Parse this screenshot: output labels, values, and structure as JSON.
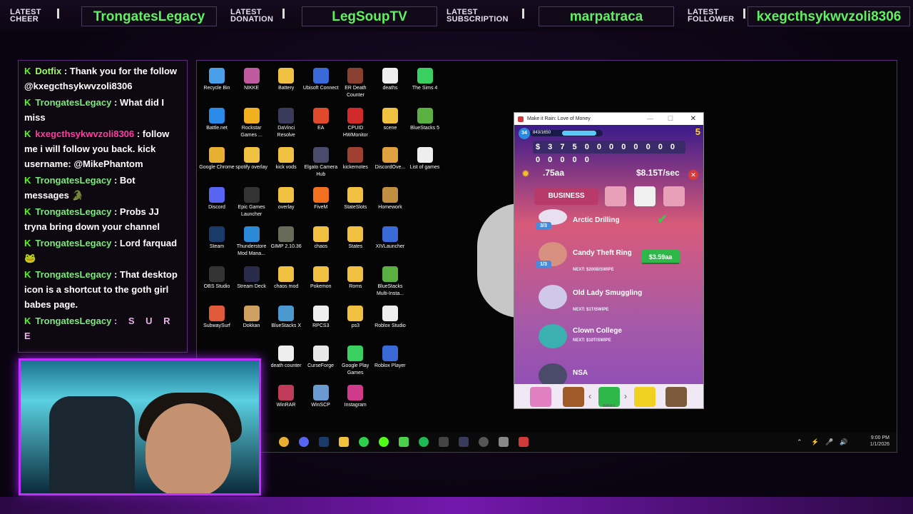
{
  "alerts": [
    {
      "tag_line1": "LATEST",
      "tag_line2": "CHEER",
      "value": "TrongatesLegacy"
    },
    {
      "tag_line1": "LATEST",
      "tag_line2": "DONATION",
      "value": "LegSoupTV"
    },
    {
      "tag_line1": "LATEST",
      "tag_line2": "SUBSCRIPTION",
      "value": "marpatraca"
    },
    {
      "tag_line1": "LATEST",
      "tag_line2": "FOLLOWER",
      "value": "kxegcthsykwvzoli8306"
    }
  ],
  "chat": {
    "messages": [
      {
        "user": "Dotfix",
        "text": ": Thank you for the follow @kxegcthsykwvzoli8306"
      },
      {
        "user": "TrongatesLegacy",
        "text": ": What did I miss"
      },
      {
        "user": "kxegcthsykwvzoli8306",
        "text": ": follow me i will follow you back. kick username: @MikePhantom"
      },
      {
        "user": "TrongatesLegacy",
        "text": ": Bot messages"
      },
      {
        "user": "TrongatesLegacy",
        "text": ": Probs JJ tryna bring down your channel"
      },
      {
        "user": "TrongatesLegacy",
        "text": ": Lord farquad"
      },
      {
        "user": "TrongatesLegacy",
        "text": ": That desktop icon is a shortcut to the goth girl babes page."
      },
      {
        "user": "TrongatesLegacy",
        "text": ": S U R E"
      }
    ]
  },
  "desktop_icons": [
    {
      "label": "Recycle Bin",
      "color": "#4aa0e8"
    },
    {
      "label": "NIKKE",
      "color": "#c05aa0"
    },
    {
      "label": "Battery",
      "color": "#f0c040"
    },
    {
      "label": "Ubisoft Connect",
      "color": "#3a6ad8"
    },
    {
      "label": "ER Death Counter",
      "color": "#8a4030"
    },
    {
      "label": "deaths",
      "color": "#eeeeee"
    },
    {
      "label": "The Sims 4",
      "color": "#3ad060"
    },
    {
      "label": "Battle.net",
      "color": "#2a8ae8"
    },
    {
      "label": "Rockstar Games ...",
      "color": "#f0b020"
    },
    {
      "label": "DaVinci Resolve",
      "color": "#3a3a5a"
    },
    {
      "label": "EA",
      "color": "#e04a2a"
    },
    {
      "label": "CPUID HWMonitor",
      "color": "#d02a2a"
    },
    {
      "label": "scene",
      "color": "#f0c040"
    },
    {
      "label": "BlueStacks 5",
      "color": "#5ab040"
    },
    {
      "label": "Google Chrome",
      "color": "#e8b030"
    },
    {
      "label": "spotify overlay",
      "color": "#f0c040"
    },
    {
      "label": "kick vods",
      "color": "#f0c040"
    },
    {
      "label": "Elgato Camera Hub",
      "color": "#4a4a6a"
    },
    {
      "label": "kickemotes",
      "color": "#a04030"
    },
    {
      "label": "DiscordOve...",
      "color": "#e0a040"
    },
    {
      "label": "List of games",
      "color": "#eeeeee"
    },
    {
      "label": "Discord",
      "color": "#5865f2"
    },
    {
      "label": "Epic Games Launcher",
      "color": "#333333"
    },
    {
      "label": "overlay",
      "color": "#f0c040"
    },
    {
      "label": "FiveM",
      "color": "#f07020"
    },
    {
      "label": "StateSlots",
      "color": "#f0c040"
    },
    {
      "label": "Homework",
      "color": "#c09040"
    },
    {
      "label": "Steam",
      "color": "#1a3a6a"
    },
    {
      "label": "Thunderstore Mod Mana...",
      "color": "#2a8ad8"
    },
    {
      "label": "GIMP 2.10.36",
      "color": "#6a6a5a"
    },
    {
      "label": "chaos",
      "color": "#f0c040"
    },
    {
      "label": "States",
      "color": "#f0c040"
    },
    {
      "label": "XIVLauncher",
      "color": "#3a6ad8"
    },
    {
      "label": "OBS Studio",
      "color": "#333333"
    },
    {
      "label": "Stream Deck",
      "color": "#2a2a4a"
    },
    {
      "label": "chaos mod",
      "color": "#f0c040"
    },
    {
      "label": "Pokemon",
      "color": "#f0c040"
    },
    {
      "label": "Roms",
      "color": "#f0c040"
    },
    {
      "label": "BlueStacks Multi-Insta...",
      "color": "#5ab040"
    },
    {
      "label": "SubwaySurf",
      "color": "#e05a3a"
    },
    {
      "label": "Dokkan",
      "color": "#d0a060"
    },
    {
      "label": "BlueStacks X",
      "color": "#4a9ad0"
    },
    {
      "label": "RPCS3",
      "color": "#eeeeee"
    },
    {
      "label": "ps3",
      "color": "#f0c040"
    },
    {
      "label": "Roblox Studio",
      "color": "#eeeeee"
    },
    {
      "label": "death counter",
      "color": "#eeeeee"
    },
    {
      "label": "CurseForge",
      "color": "#e8e8e8"
    },
    {
      "label": "Google Play Games",
      "color": "#3ad060"
    },
    {
      "label": "Roblox Player",
      "color": "#3a6ad8"
    },
    {
      "label": "WinRAR",
      "color": "#c03a5a"
    },
    {
      "label": "WinSCP",
      "color": "#6a9ad0"
    },
    {
      "label": "Instagram",
      "color": "#d03a8a"
    }
  ],
  "game": {
    "window_title": "Make it Rain: Love of Money",
    "level": "34",
    "xp": "843/1650",
    "xp_fraction": 0.51,
    "coins": "5",
    "counter": "$ 3 7 5 0 0 0 0 0 0 0 0 0 0 0 0 0",
    "money_left": ".75aa",
    "money_right": "$8.15T/sec",
    "tab_label": "BUSINESS",
    "businesses": [
      {
        "name": "Arctic Drilling",
        "badge": "3/3",
        "next": "",
        "color": "#e8e0f0"
      },
      {
        "name": "Candy Theft Ring",
        "badge": "1/3",
        "next": "NEXT: $200B/SWIPE",
        "color": "#d89080"
      },
      {
        "name": "Old Lady Smuggling",
        "badge": "",
        "next": "NEXT: $1T/SWIPE",
        "color": "#d0c8e8"
      },
      {
        "name": "Clown College",
        "badge": "",
        "next": "NEXT: $10T/SWIPE",
        "color": "#3ab0b0"
      },
      {
        "name": "NSA",
        "badge": "",
        "next": "",
        "color": "#4a4a6a"
      }
    ],
    "buy_price": "$3.59aa",
    "nav_caption": "BANKS"
  },
  "taskbar": {
    "time": "9:00 PM",
    "date": "1/1/2026"
  }
}
